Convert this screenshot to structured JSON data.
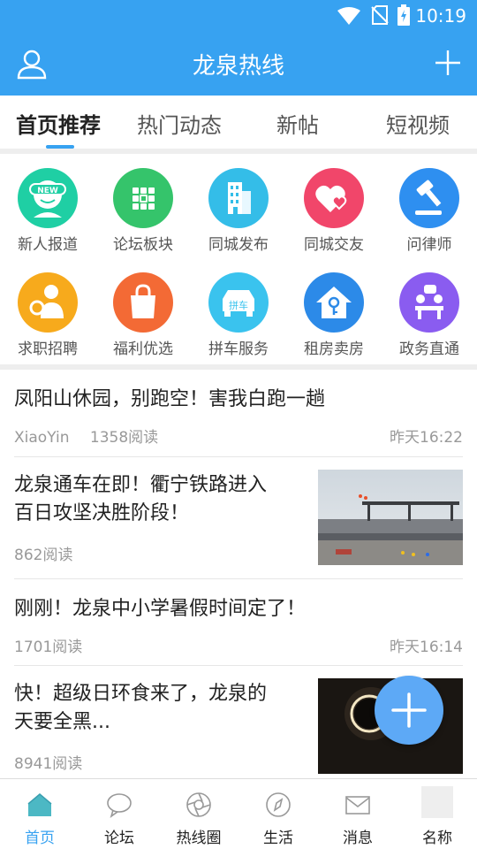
{
  "status_bar": {
    "time": "10:19"
  },
  "header": {
    "title": "龙泉热线",
    "user_icon": "user-icon",
    "add_icon": "plus-icon"
  },
  "tabs": [
    {
      "label": "首页推荐",
      "active": true
    },
    {
      "label": "热门动态"
    },
    {
      "label": "新帖"
    },
    {
      "label": "短视频"
    }
  ],
  "grid": [
    {
      "label": "新人报道",
      "icon": "new-user-icon",
      "color": "#1fcfa4"
    },
    {
      "label": "论坛板块",
      "icon": "grid-icon",
      "color": "#35c46b"
    },
    {
      "label": "同城发布",
      "icon": "building-icon",
      "color": "#34bde8"
    },
    {
      "label": "同城交友",
      "icon": "hearts-icon",
      "color": "#f1466a"
    },
    {
      "label": "问律师",
      "icon": "gavel-icon",
      "color": "#2e8ff0"
    },
    {
      "label": "求职招聘",
      "icon": "job-search-icon",
      "color": "#f7aa1c"
    },
    {
      "label": "福利优选",
      "icon": "shopping-bag-icon",
      "color": "#f36a35"
    },
    {
      "label": "拼车服务",
      "icon": "car-icon",
      "color": "#3ac3ee",
      "car_text": "拼车"
    },
    {
      "label": "租房卖房",
      "icon": "house-icon",
      "color": "#2c8ae8"
    },
    {
      "label": "政务直通",
      "icon": "meeting-icon",
      "color": "#8a5cf0"
    }
  ],
  "feed": [
    {
      "title": "凤阳山休园，别跑空！害我白跑一趟",
      "author": "XiaoYin",
      "reads": "1358阅读",
      "time": "昨天16:22"
    },
    {
      "title_line1": "龙泉通车在即！衢宁铁路进入",
      "title_line2": "百日攻坚决胜阶段！",
      "reads": "862阅读",
      "thumb": "railway-construction"
    },
    {
      "title": "刚刚！龙泉中小学暑假时间定了！",
      "reads": "1701阅读",
      "time": "昨天16:14"
    },
    {
      "title_line1": "快！超级日环食来了，龙泉的",
      "title_line2": "天要全黑...",
      "reads": "8941阅读",
      "thumb": "solar-eclipse"
    }
  ],
  "bottom_nav": [
    {
      "label": "首页",
      "icon": "home-icon",
      "active": true
    },
    {
      "label": "论坛",
      "icon": "chat-icon"
    },
    {
      "label": "热线圈",
      "icon": "aperture-icon"
    },
    {
      "label": "生活",
      "icon": "compass-icon"
    },
    {
      "label": "消息",
      "icon": "mail-icon"
    },
    {
      "label": "名称",
      "icon": "placeholder-icon"
    }
  ],
  "colors": {
    "primary": "#37a2f1",
    "fab": "#5da9f6"
  }
}
